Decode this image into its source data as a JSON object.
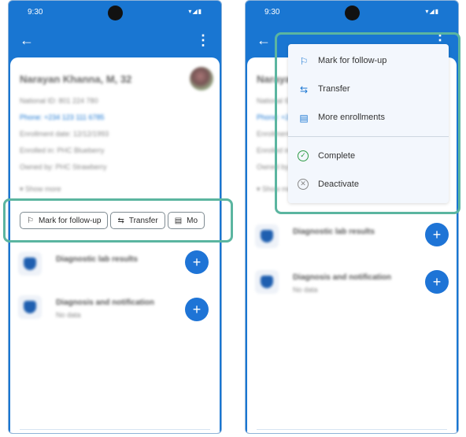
{
  "status_bar": {
    "time": "9:30"
  },
  "patient": {
    "name": "Narayan Khanna, M, 32",
    "details": [
      "National ID: 801 224 780",
      "Phone: +234 123 111 6785",
      "Enrollment date: 12/12/1993",
      "Enrolled in: PHC Blueberry",
      "Owned by: PHC Strawberry"
    ],
    "show_more": "Show more"
  },
  "chips": [
    {
      "label": "Mark for follow-up",
      "icon": "flag-icon"
    },
    {
      "label": "Transfer",
      "icon": "transfer-icon"
    },
    {
      "label": "Mo",
      "icon": "clipboard-icon"
    }
  ],
  "sections": [
    {
      "title": "Diagnostic lab results",
      "subtitle": ""
    },
    {
      "title": "Diagnosis and notification",
      "subtitle": "No data"
    }
  ],
  "menu": {
    "items": [
      {
        "label": "Mark for follow-up",
        "icon": "flag-icon"
      },
      {
        "label": "Transfer",
        "icon": "transfer-icon"
      },
      {
        "label": "More enrollments",
        "icon": "clipboard-icon"
      },
      {
        "label": "Complete",
        "icon": "check-circle-icon"
      },
      {
        "label": "Deactivate",
        "icon": "x-circle-icon"
      }
    ]
  },
  "colors": {
    "primary": "#1976d2",
    "highlight": "#5bb5a0",
    "complete": "#2e9b46"
  }
}
